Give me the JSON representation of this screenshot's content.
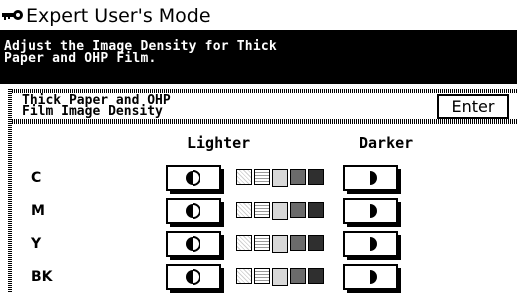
{
  "title_bar": {
    "title": "Expert User's Mode",
    "icon": "key-icon"
  },
  "message": {
    "line1": "Adjust the Image Density for Thick",
    "line2": "Paper and OHP Film."
  },
  "panel": {
    "title_line1": "Thick Paper and OHP",
    "title_line2": "Film Image Density",
    "enter_label": "Enter",
    "col_lighter": "Lighter",
    "col_darker": "Darker",
    "rows": [
      {
        "label": "C",
        "level": 3
      },
      {
        "label": "M",
        "level": 3
      },
      {
        "label": "Y",
        "level": 3
      },
      {
        "label": "BK",
        "level": 3
      }
    ],
    "scale_steps": 5
  }
}
